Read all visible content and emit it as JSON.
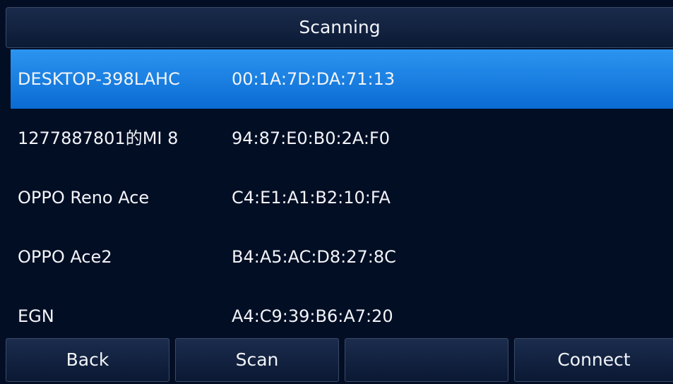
{
  "header": {
    "title": "Scanning"
  },
  "devices": [
    {
      "name": "DESKTOP-398LAHC",
      "mac": "00:1A:7D:DA:71:13",
      "selected": true
    },
    {
      "name": "1277887801的MI 8",
      "mac": "94:87:E0:B0:2A:F0",
      "selected": false
    },
    {
      "name": "OPPO Reno Ace",
      "mac": "C4:E1:A1:B2:10:FA",
      "selected": false
    },
    {
      "name": "OPPO Ace2",
      "mac": "B4:A5:AC:D8:27:8C",
      "selected": false
    },
    {
      "name": "EGN",
      "mac": "A4:C9:39:B6:A7:20",
      "selected": false
    }
  ],
  "softkeys": {
    "back": "Back",
    "scan": "Scan",
    "empty": "",
    "connect": "Connect"
  },
  "colors": {
    "background": "#030e25",
    "selected_row": "#1a80e6",
    "text": "#f2f4f8"
  }
}
